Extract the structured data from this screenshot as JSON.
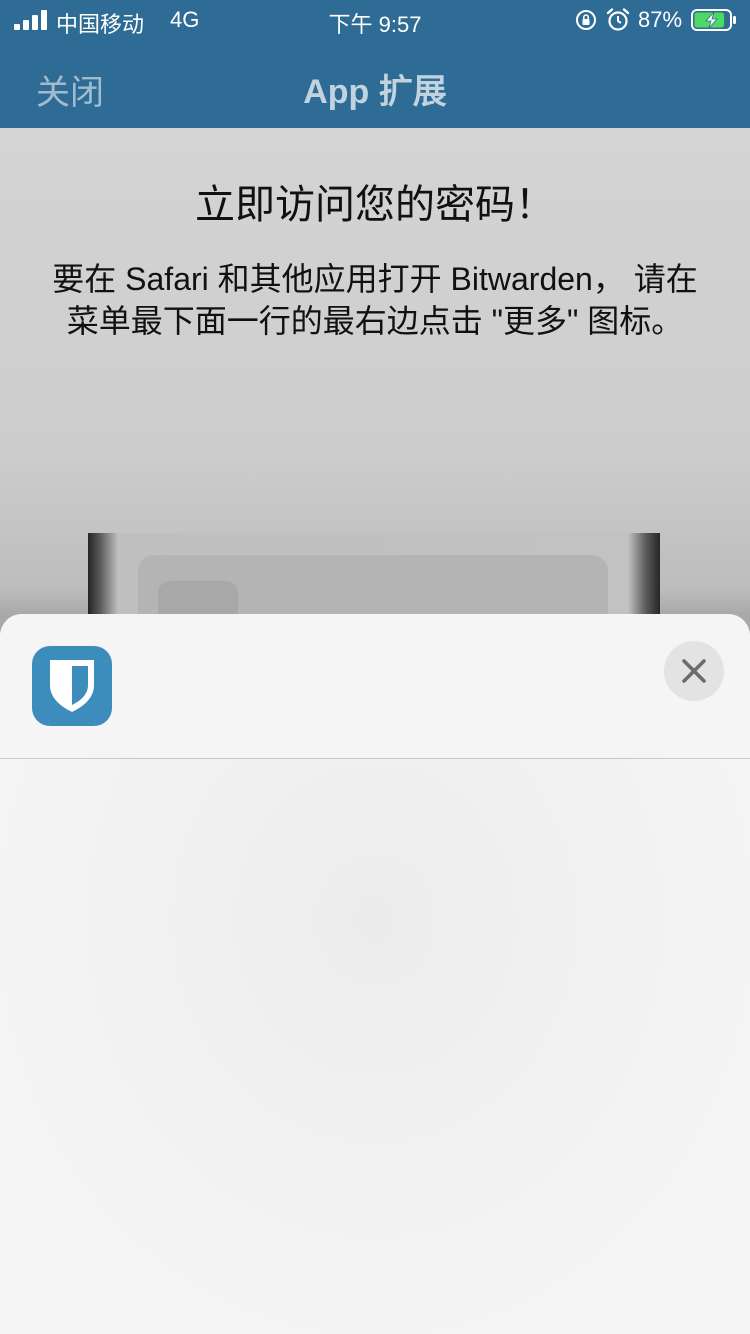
{
  "status_bar": {
    "carrier": "中国移动",
    "network": "4G",
    "time": "下午 9:57",
    "battery_percent": "87%",
    "battery_level": 0.87,
    "icons": [
      "signal-icon",
      "orientation-lock-icon",
      "alarm-icon",
      "battery-charging-icon"
    ]
  },
  "nav": {
    "close_label": "关闭",
    "title": "App 扩展"
  },
  "content": {
    "headline": "立即访问您的密码！",
    "instructions": "要在 Safari 和其他应用打开 Bitwarden， 请在菜单最下面一行的最右边点击 \"更多\" 图标。"
  },
  "share_sheet": {
    "app_icon": "bitwarden-shield-icon",
    "close_icon": "close-icon"
  },
  "colors": {
    "header_bg": "#2f6c95",
    "app_icon_bg": "#3c8dbc",
    "battery_fill": "#4cd964"
  }
}
